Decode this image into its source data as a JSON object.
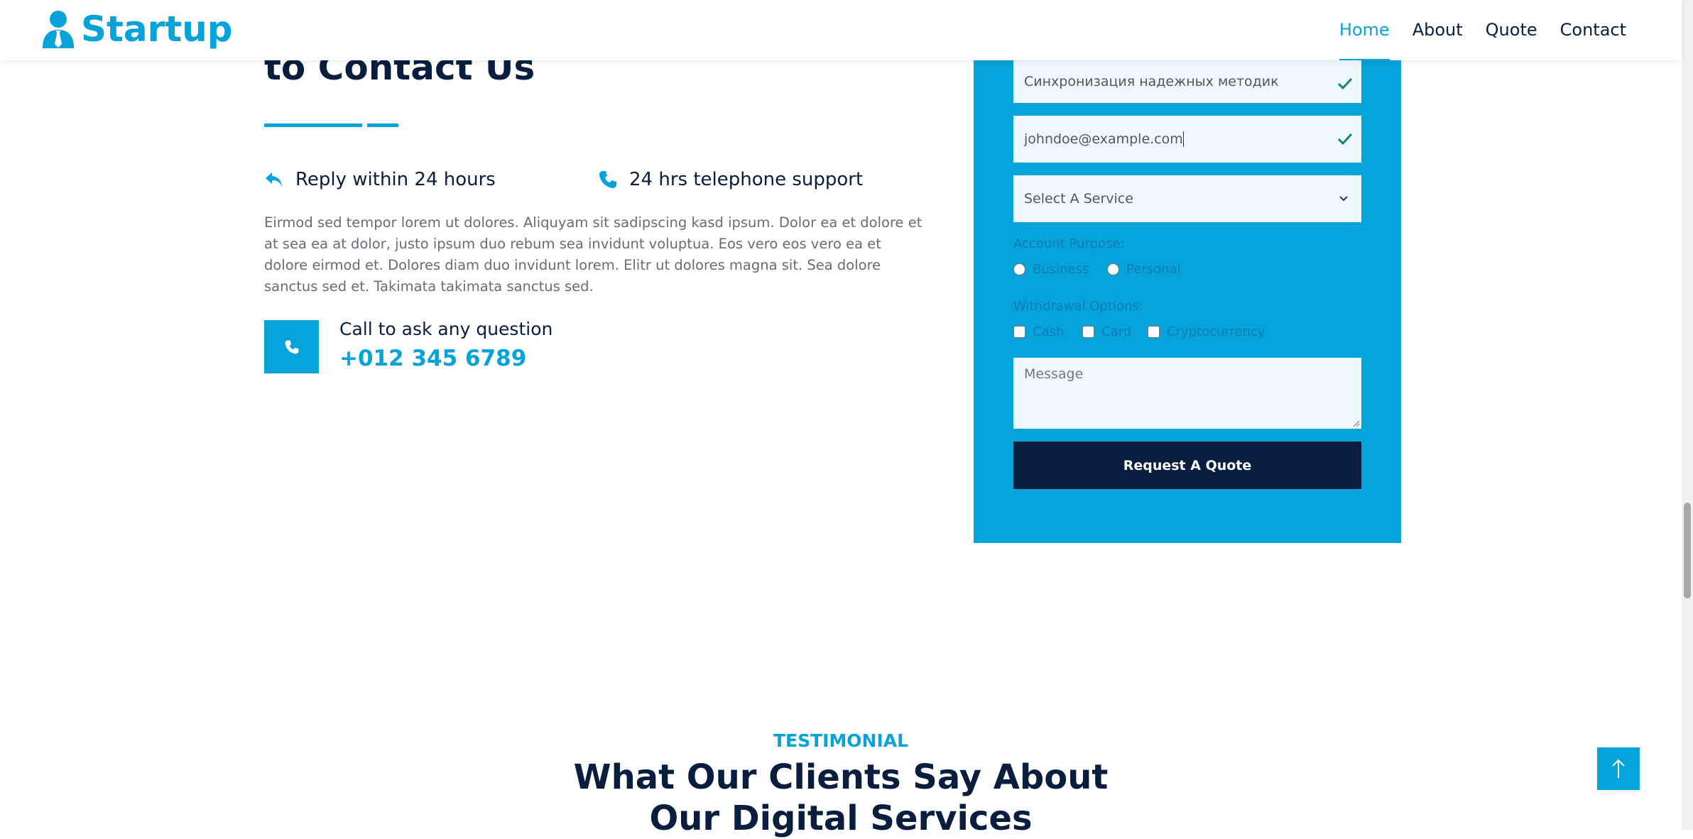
{
  "brand": {
    "name": "Startup",
    "icon": "user-tie-icon"
  },
  "nav": {
    "items": [
      {
        "label": "Home",
        "active": true
      },
      {
        "label": "About",
        "active": false
      },
      {
        "label": "Quote",
        "active": false
      },
      {
        "label": "Contact",
        "active": false
      }
    ]
  },
  "section": {
    "heading_line2": "to Contact Us",
    "features": [
      {
        "icon": "reply-icon",
        "label": "Reply within 24 hours"
      },
      {
        "icon": "phone-icon",
        "label": "24 hrs telephone support"
      }
    ],
    "paragraph": "Eirmod sed tempor lorem ut dolores. Aliquyam sit sadipscing kasd ipsum. Dolor ea et dolore et at sea ea at dolor, justo ipsum duo rebum sea invidunt voluptua. Eos vero eos vero ea et dolore eirmod et. Dolores diam duo invidunt lorem. Elitr ut dolores magna sit. Sea dolore sanctus sed et. Takimata takimata sanctus sed.",
    "call_label": "Call to ask any question",
    "call_number": "+012 345 6789"
  },
  "form": {
    "name_value": "Синхронизация надежных методик",
    "email_value": "johndoe@example.com",
    "service_selected": "Select A Service",
    "purpose_label": "Account Purpose:",
    "purpose_options": [
      "Business",
      "Personal"
    ],
    "withdraw_label": "Withdrawal Options:",
    "withdraw_options": [
      "Cash",
      "Card",
      "Cryptocurrency"
    ],
    "message_placeholder": "Message",
    "submit_label": "Request A Quote"
  },
  "testimonial": {
    "kicker": "TESTIMONIAL",
    "title_line1": "What Our Clients Say About",
    "title_line2": "Our Digital Services"
  },
  "colors": {
    "primary": "#06A3DA",
    "dark": "#091E3E",
    "input_bg": "#EEF9FF"
  }
}
